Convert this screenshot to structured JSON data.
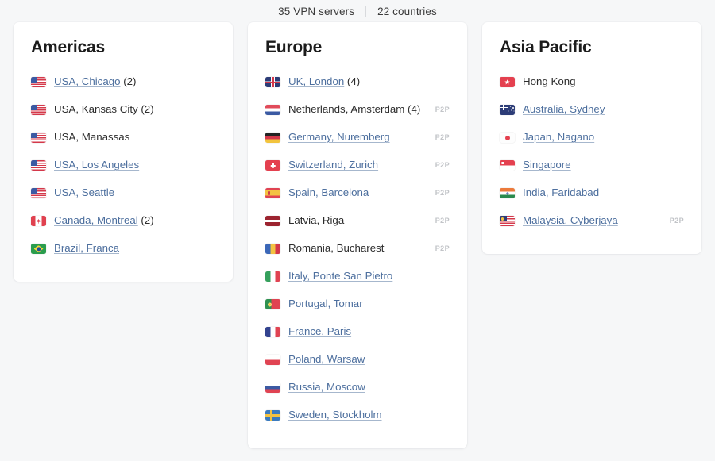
{
  "header": {
    "servers": "35 VPN servers",
    "countries": "22 countries"
  },
  "columns": [
    {
      "title": "Americas",
      "rows": [
        {
          "flag": "us-flag",
          "name": "USA, Chicago",
          "link": true,
          "count": " (2)",
          "p2p": ""
        },
        {
          "flag": "us-flag",
          "name": "USA, Kansas City",
          "link": false,
          "count": " (2)",
          "p2p": ""
        },
        {
          "flag": "us-flag",
          "name": "USA, Manassas",
          "link": false,
          "count": "",
          "p2p": ""
        },
        {
          "flag": "us-flag",
          "name": "USA, Los Angeles",
          "link": true,
          "count": "",
          "p2p": ""
        },
        {
          "flag": "us-flag",
          "name": "USA, Seattle",
          "link": true,
          "count": "",
          "p2p": ""
        },
        {
          "flag": "ca-flag",
          "name": "Canada, Montreal",
          "link": true,
          "count": " (2)",
          "p2p": ""
        },
        {
          "flag": "br-flag",
          "name": "Brazil, Franca",
          "link": true,
          "count": "",
          "p2p": ""
        }
      ]
    },
    {
      "title": "Europe",
      "rows": [
        {
          "flag": "uk-flag",
          "name": "UK, London",
          "link": true,
          "count": " (4)",
          "p2p": ""
        },
        {
          "flag": "nl-flag",
          "name": "Netherlands, Amsterdam",
          "link": false,
          "count": " (4)",
          "p2p": "P2P"
        },
        {
          "flag": "de-flag",
          "name": "Germany, Nuremberg",
          "link": true,
          "count": "",
          "p2p": "P2P"
        },
        {
          "flag": "ch-flag",
          "name": "Switzerland, Zurich",
          "link": true,
          "count": "",
          "p2p": "P2P"
        },
        {
          "flag": "es-flag",
          "name": "Spain, Barcelona",
          "link": true,
          "count": "",
          "p2p": "P2P"
        },
        {
          "flag": "lv-flag",
          "name": "Latvia, Riga",
          "link": false,
          "count": "",
          "p2p": "P2P"
        },
        {
          "flag": "ro-flag",
          "name": "Romania, Bucharest",
          "link": false,
          "count": "",
          "p2p": "P2P"
        },
        {
          "flag": "it-flag",
          "name": "Italy, Ponte San Pietro",
          "link": true,
          "count": "",
          "p2p": ""
        },
        {
          "flag": "pt-flag",
          "name": "Portugal, Tomar",
          "link": true,
          "count": "",
          "p2p": ""
        },
        {
          "flag": "fr-flag",
          "name": "France, Paris",
          "link": true,
          "count": "",
          "p2p": ""
        },
        {
          "flag": "pl-flag",
          "name": "Poland, Warsaw",
          "link": true,
          "count": "",
          "p2p": ""
        },
        {
          "flag": "ru-flag",
          "name": "Russia, Moscow",
          "link": true,
          "count": "",
          "p2p": ""
        },
        {
          "flag": "se-flag",
          "name": "Sweden, Stockholm",
          "link": true,
          "count": "",
          "p2p": ""
        }
      ]
    },
    {
      "title": "Asia Pacific",
      "rows": [
        {
          "flag": "hk-flag",
          "name": "Hong Kong",
          "link": false,
          "count": "",
          "p2p": ""
        },
        {
          "flag": "au-flag",
          "name": "Australia, Sydney",
          "link": true,
          "count": "",
          "p2p": ""
        },
        {
          "flag": "jp-flag",
          "name": "Japan, Nagano",
          "link": true,
          "count": "",
          "p2p": ""
        },
        {
          "flag": "sg-flag",
          "name": "Singapore",
          "link": true,
          "count": "",
          "p2p": ""
        },
        {
          "flag": "in-flag",
          "name": "India, Faridabad",
          "link": true,
          "count": "",
          "p2p": ""
        },
        {
          "flag": "my-flag",
          "name": "Malaysia, Cyberjaya",
          "link": true,
          "count": "",
          "p2p": "P2P"
        }
      ]
    }
  ],
  "colors": {
    "page_background": "#f6f7f8",
    "card_background": "#ffffff",
    "link": "#4d6f9e",
    "text": "#2d2d2d",
    "p2p_badge": "#c2c4c8"
  }
}
